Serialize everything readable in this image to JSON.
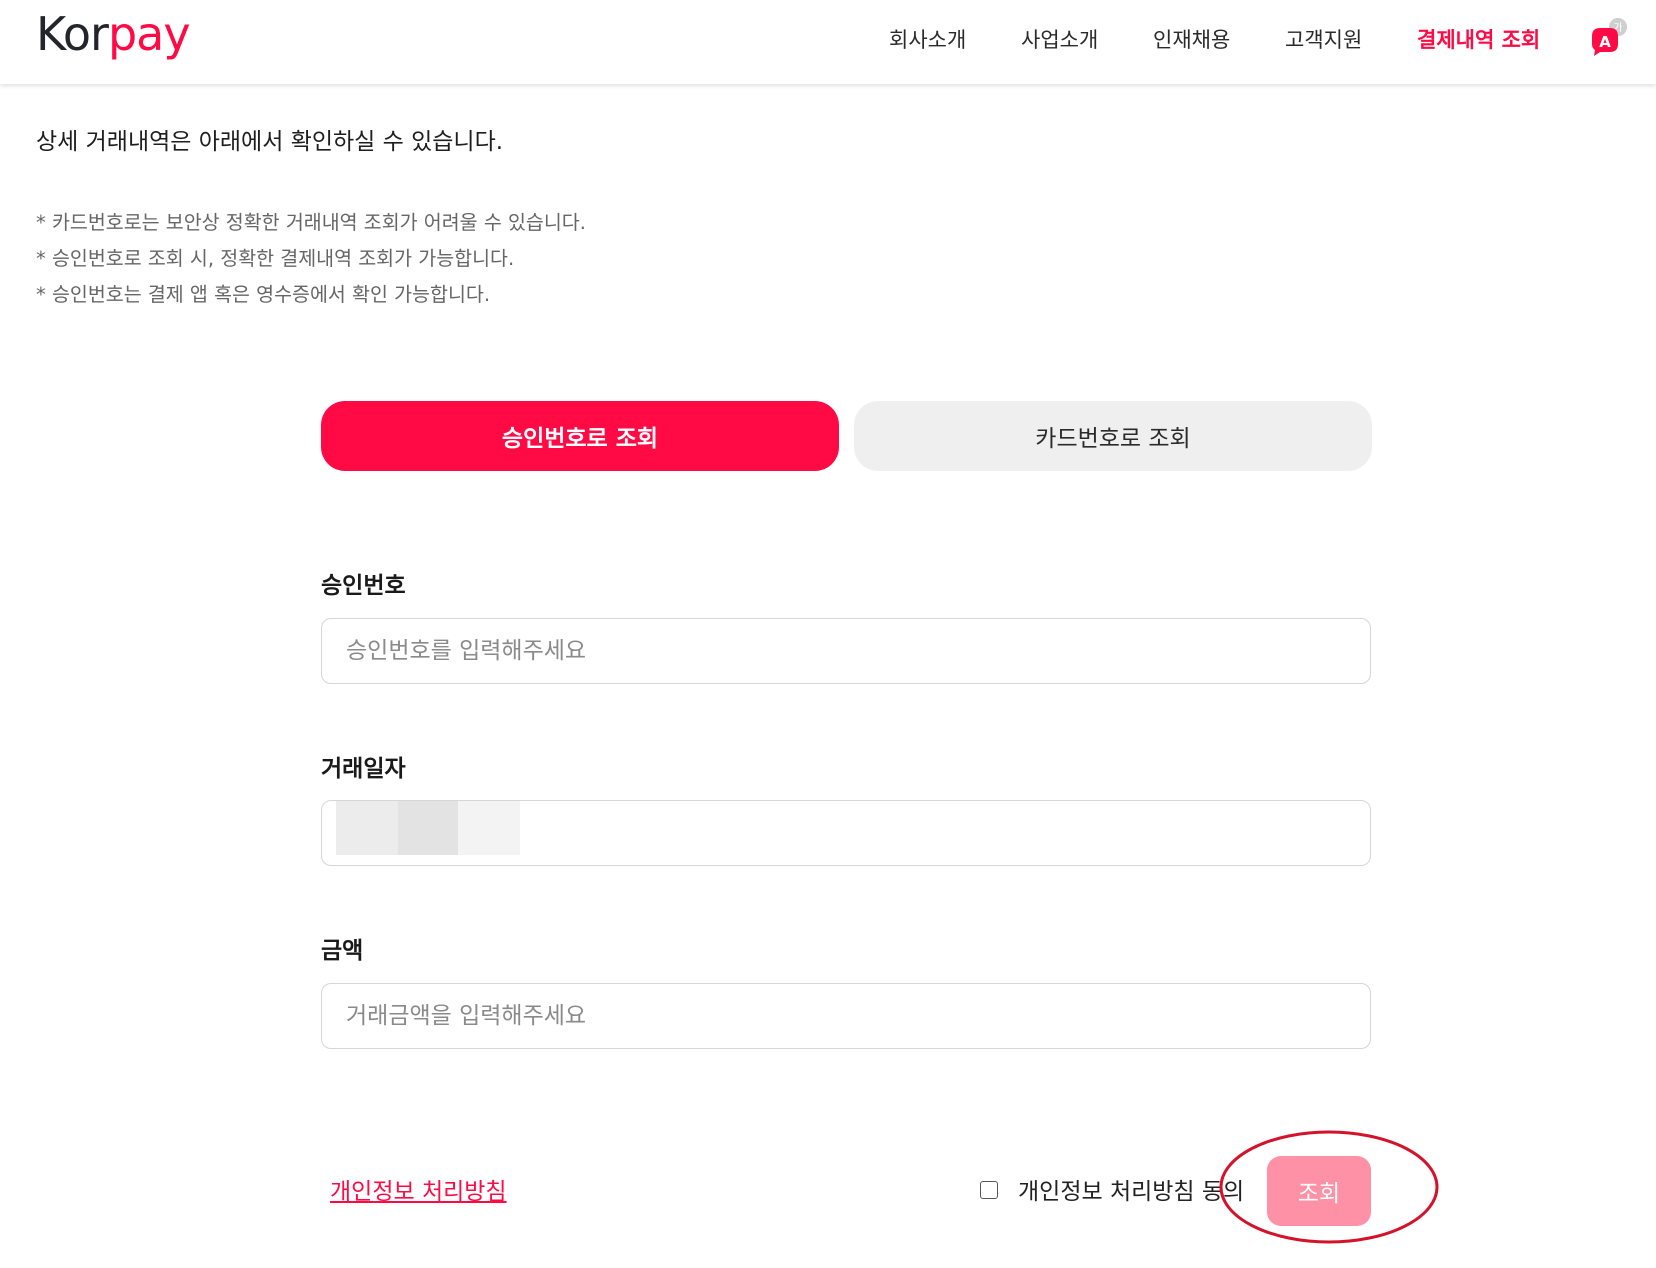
{
  "header": {
    "logo": {
      "part1": "Kor",
      "part2": "pay"
    },
    "nav": [
      {
        "label": "회사소개",
        "active": false
      },
      {
        "label": "사업소개",
        "active": false
      },
      {
        "label": "인재채용",
        "active": false
      },
      {
        "label": "고객지원",
        "active": false
      },
      {
        "label": "결제내역 조회",
        "active": true
      }
    ],
    "translate_icon": "translate-icon",
    "translate_badge": "가"
  },
  "intro": "상세 거래내역은 아래에서 확인하실 수 있습니다.",
  "notes": [
    "* 카드번호로는 보안상 정확한 거래내역 조회가 어려울 수 있습니다.",
    "* 승인번호로 조회 시, 정확한 결제내역 조회가 가능합니다.",
    "* 승인번호는 결제 앱 혹은 영수증에서 확인 가능합니다."
  ],
  "tabs": [
    {
      "label": "승인번호로 조회",
      "selected": true
    },
    {
      "label": "카드번호로 조회",
      "selected": false
    }
  ],
  "form": {
    "approval": {
      "label": "승인번호",
      "placeholder": "승인번호를 입력해주세요",
      "value": ""
    },
    "date": {
      "label": "거래일자",
      "value_blurred": true
    },
    "amount": {
      "label": "금액",
      "placeholder": "거래금액을 입력해주세요",
      "value": ""
    }
  },
  "footer": {
    "privacy_link": "개인정보 처리방침",
    "agree_label": "개인정보 처리방침 동의",
    "agree_checked": false,
    "submit_label": "조회"
  },
  "colors": {
    "brand": "#ff0a45",
    "submit_disabled": "#ff91a6",
    "tab_inactive_bg": "#efefef",
    "annotation": "#d4122a"
  }
}
